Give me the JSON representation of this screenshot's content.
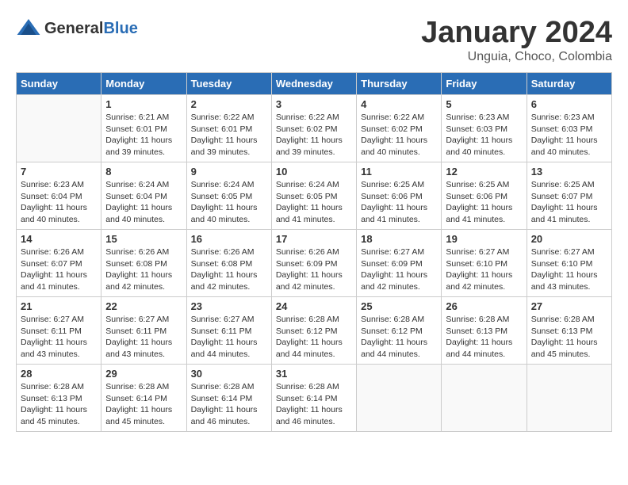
{
  "header": {
    "logo_general": "General",
    "logo_blue": "Blue",
    "month_title": "January 2024",
    "location": "Unguia, Choco, Colombia"
  },
  "weekdays": [
    "Sunday",
    "Monday",
    "Tuesday",
    "Wednesday",
    "Thursday",
    "Friday",
    "Saturday"
  ],
  "weeks": [
    [
      {
        "day": "",
        "info": ""
      },
      {
        "day": "1",
        "info": "Sunrise: 6:21 AM\nSunset: 6:01 PM\nDaylight: 11 hours\nand 39 minutes."
      },
      {
        "day": "2",
        "info": "Sunrise: 6:22 AM\nSunset: 6:01 PM\nDaylight: 11 hours\nand 39 minutes."
      },
      {
        "day": "3",
        "info": "Sunrise: 6:22 AM\nSunset: 6:02 PM\nDaylight: 11 hours\nand 39 minutes."
      },
      {
        "day": "4",
        "info": "Sunrise: 6:22 AM\nSunset: 6:02 PM\nDaylight: 11 hours\nand 40 minutes."
      },
      {
        "day": "5",
        "info": "Sunrise: 6:23 AM\nSunset: 6:03 PM\nDaylight: 11 hours\nand 40 minutes."
      },
      {
        "day": "6",
        "info": "Sunrise: 6:23 AM\nSunset: 6:03 PM\nDaylight: 11 hours\nand 40 minutes."
      }
    ],
    [
      {
        "day": "7",
        "info": "Sunrise: 6:23 AM\nSunset: 6:04 PM\nDaylight: 11 hours\nand 40 minutes."
      },
      {
        "day": "8",
        "info": "Sunrise: 6:24 AM\nSunset: 6:04 PM\nDaylight: 11 hours\nand 40 minutes."
      },
      {
        "day": "9",
        "info": "Sunrise: 6:24 AM\nSunset: 6:05 PM\nDaylight: 11 hours\nand 40 minutes."
      },
      {
        "day": "10",
        "info": "Sunrise: 6:24 AM\nSunset: 6:05 PM\nDaylight: 11 hours\nand 41 minutes."
      },
      {
        "day": "11",
        "info": "Sunrise: 6:25 AM\nSunset: 6:06 PM\nDaylight: 11 hours\nand 41 minutes."
      },
      {
        "day": "12",
        "info": "Sunrise: 6:25 AM\nSunset: 6:06 PM\nDaylight: 11 hours\nand 41 minutes."
      },
      {
        "day": "13",
        "info": "Sunrise: 6:25 AM\nSunset: 6:07 PM\nDaylight: 11 hours\nand 41 minutes."
      }
    ],
    [
      {
        "day": "14",
        "info": "Sunrise: 6:26 AM\nSunset: 6:07 PM\nDaylight: 11 hours\nand 41 minutes."
      },
      {
        "day": "15",
        "info": "Sunrise: 6:26 AM\nSunset: 6:08 PM\nDaylight: 11 hours\nand 42 minutes."
      },
      {
        "day": "16",
        "info": "Sunrise: 6:26 AM\nSunset: 6:08 PM\nDaylight: 11 hours\nand 42 minutes."
      },
      {
        "day": "17",
        "info": "Sunrise: 6:26 AM\nSunset: 6:09 PM\nDaylight: 11 hours\nand 42 minutes."
      },
      {
        "day": "18",
        "info": "Sunrise: 6:27 AM\nSunset: 6:09 PM\nDaylight: 11 hours\nand 42 minutes."
      },
      {
        "day": "19",
        "info": "Sunrise: 6:27 AM\nSunset: 6:10 PM\nDaylight: 11 hours\nand 42 minutes."
      },
      {
        "day": "20",
        "info": "Sunrise: 6:27 AM\nSunset: 6:10 PM\nDaylight: 11 hours\nand 43 minutes."
      }
    ],
    [
      {
        "day": "21",
        "info": "Sunrise: 6:27 AM\nSunset: 6:11 PM\nDaylight: 11 hours\nand 43 minutes."
      },
      {
        "day": "22",
        "info": "Sunrise: 6:27 AM\nSunset: 6:11 PM\nDaylight: 11 hours\nand 43 minutes."
      },
      {
        "day": "23",
        "info": "Sunrise: 6:27 AM\nSunset: 6:11 PM\nDaylight: 11 hours\nand 44 minutes."
      },
      {
        "day": "24",
        "info": "Sunrise: 6:28 AM\nSunset: 6:12 PM\nDaylight: 11 hours\nand 44 minutes."
      },
      {
        "day": "25",
        "info": "Sunrise: 6:28 AM\nSunset: 6:12 PM\nDaylight: 11 hours\nand 44 minutes."
      },
      {
        "day": "26",
        "info": "Sunrise: 6:28 AM\nSunset: 6:13 PM\nDaylight: 11 hours\nand 44 minutes."
      },
      {
        "day": "27",
        "info": "Sunrise: 6:28 AM\nSunset: 6:13 PM\nDaylight: 11 hours\nand 45 minutes."
      }
    ],
    [
      {
        "day": "28",
        "info": "Sunrise: 6:28 AM\nSunset: 6:13 PM\nDaylight: 11 hours\nand 45 minutes."
      },
      {
        "day": "29",
        "info": "Sunrise: 6:28 AM\nSunset: 6:14 PM\nDaylight: 11 hours\nand 45 minutes."
      },
      {
        "day": "30",
        "info": "Sunrise: 6:28 AM\nSunset: 6:14 PM\nDaylight: 11 hours\nand 46 minutes."
      },
      {
        "day": "31",
        "info": "Sunrise: 6:28 AM\nSunset: 6:14 PM\nDaylight: 11 hours\nand 46 minutes."
      },
      {
        "day": "",
        "info": ""
      },
      {
        "day": "",
        "info": ""
      },
      {
        "day": "",
        "info": ""
      }
    ]
  ]
}
